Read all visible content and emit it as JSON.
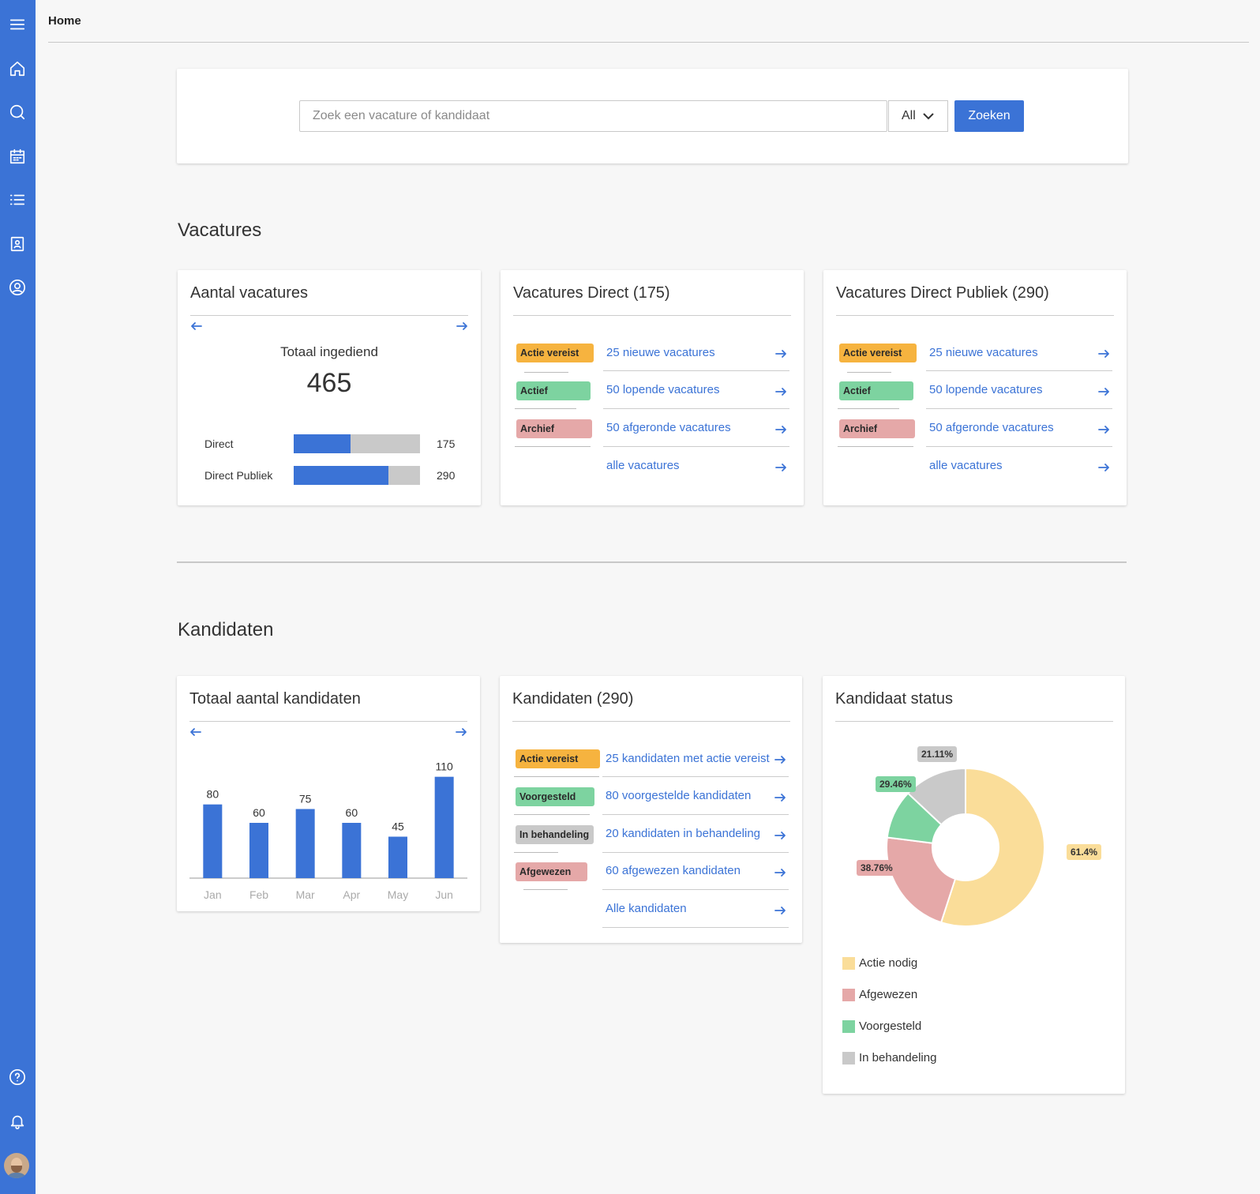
{
  "header": {
    "title": "Home"
  },
  "search": {
    "placeholder": "Zoek een vacature of kandidaat",
    "select_value": "All",
    "button_label": "Zoeken"
  },
  "sections": {
    "vacatures": "Vacatures",
    "kandidaten": "Kandidaten"
  },
  "aantal": {
    "title": "Aantal vacatures",
    "total_label": "Totaal ingediend",
    "total_value": "465",
    "rows": [
      {
        "label": "Direct",
        "value": "175",
        "fill": 0.45
      },
      {
        "label": "Direct Publiek",
        "value": "290",
        "fill": 0.75
      }
    ]
  },
  "vac_direct": {
    "title": "Vacatures Direct (175)",
    "badges": [
      "Actie vereist",
      "Actief",
      "Archief"
    ],
    "links": [
      "25 nieuwe vacatures",
      "50 lopende vacatures",
      "50 afgeronde vacatures",
      "alle vacatures"
    ]
  },
  "vac_publiek": {
    "title": "Vacatures Direct Publiek (290)",
    "badges": [
      "Actie vereist",
      "Actief",
      "Archief"
    ],
    "links": [
      "25 nieuwe vacatures",
      "50 lopende vacatures",
      "50 afgeronde vacatures",
      "alle vacatures"
    ]
  },
  "kand_total": {
    "title": "Totaal aantal kandidaten"
  },
  "kandidaten": {
    "title": "Kandidaten (290)",
    "badges": [
      "Actie vereist",
      "Voorgesteld",
      "In behandeling",
      "Afgewezen"
    ],
    "links": [
      "25 kandidaten met actie vereist",
      "80 voorgestelde kandidaten",
      "20  kandidaten in behandeling",
      "60 afgewezen kandidaten",
      "Alle kandidaten"
    ]
  },
  "status": {
    "title": "Kandidaat status",
    "legend": [
      "Actie nodig",
      "Afgewezen",
      "Voorgesteld",
      "In behandeling"
    ]
  },
  "colors": {
    "accent": "#3b73d6",
    "actie": "#f6b33f",
    "actief": "#7dd3a0",
    "archief": "#e5a8a8",
    "grey": "#c9c9c9",
    "pie_actie": "#fadd99",
    "pie_afgewezen": "#e5a8a8",
    "pie_voorgesteld": "#7dd3a0",
    "pie_behandeling": "#c9c9c9"
  },
  "chart_data": [
    {
      "type": "bar",
      "title": "Totaal aantal kandidaten",
      "categories": [
        "Jan",
        "Feb",
        "Mar",
        "Apr",
        "May",
        "Jun"
      ],
      "values": [
        80,
        60,
        75,
        60,
        45,
        110
      ],
      "ylim": [
        0,
        120
      ]
    },
    {
      "type": "pie",
      "title": "Kandidaat status",
      "categories": [
        "Actie nodig",
        "Afgewezen",
        "Voorgesteld",
        "In behandeling"
      ],
      "values": [
        55,
        22,
        10,
        13
      ],
      "labels": [
        "61.4%",
        "38.76%",
        "29.46%",
        "21.11%"
      ]
    }
  ]
}
